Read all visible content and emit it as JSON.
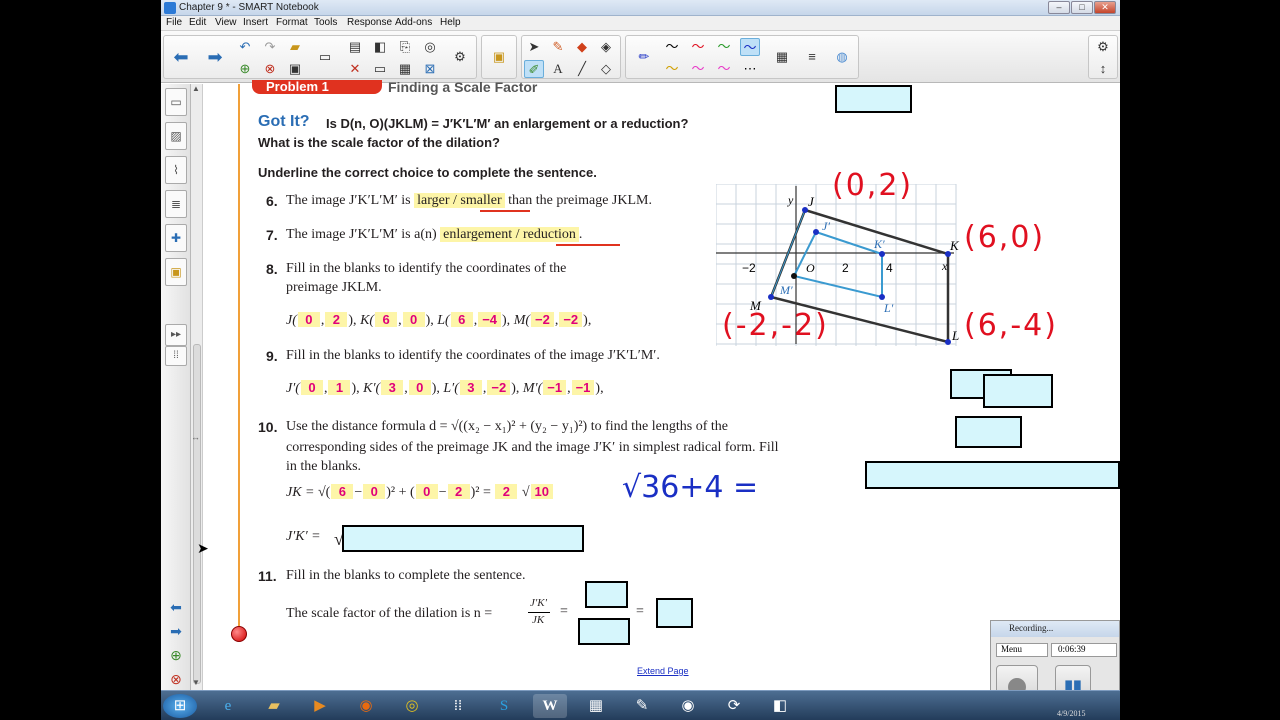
{
  "window": {
    "title": "Chapter 9 * - SMART Notebook",
    "minimize": "–",
    "maximize": "□",
    "close": "✕"
  },
  "menu": [
    "File",
    "Edit",
    "View",
    "Insert",
    "Format",
    "Tools",
    "Response",
    "Add-ons",
    "Help"
  ],
  "problem_header": {
    "label": "Problem 1",
    "title": "Finding a Scale Factor"
  },
  "got_it": {
    "label": "Got It?",
    "question_line1": "Is D(n, O)(JKLM) = J′K′L′M′ an enlargement or a reduction?",
    "question_line2": "What is the scale factor of the dilation?"
  },
  "instruction": "Underline the correct choice to complete the sentence.",
  "q6": {
    "num": "6.",
    "pre": "The image J′K′L′M′ is",
    "choice": "larger / smaller",
    "post": "than the preimage JKLM."
  },
  "q7": {
    "num": "7.",
    "pre": "The image J′K′L′M′ is a(n)",
    "choice": "enlargement / reduction",
    "post": "."
  },
  "q8": {
    "num": "8.",
    "line1": "Fill in the blanks to identify the coordinates of the",
    "line2": "preimage JKLM.",
    "J": [
      "0",
      "2"
    ],
    "K": [
      "6",
      "0"
    ],
    "L": [
      "6",
      "−4"
    ],
    "M": [
      "−2",
      "−2"
    ]
  },
  "q9": {
    "num": "9.",
    "line1": "Fill in the blanks to identify the coordinates of the image J′K′L′M′.",
    "J": [
      "0",
      "1"
    ],
    "K": [
      "3",
      "0"
    ],
    "L": [
      "3",
      "−2"
    ],
    "M": [
      "−1",
      "−1"
    ]
  },
  "q10": {
    "num": "10.",
    "line1": "Use the distance formula d = √((x₂ − x₁)² + (y₂ − y₁)²) to find the lengths of the",
    "line2": "corresponding sides of the preimage JK and the image J′K′ in simplest radical form. Fill",
    "line3": "in the blanks.",
    "jk_label": "JK =",
    "jk_a": "6",
    "jk_b": "0",
    "jk_c": "0",
    "jk_d": "2",
    "jk_coef": "2",
    "jk_rad": "10",
    "jpkp_label": "J′K′ ="
  },
  "q11": {
    "num": "11.",
    "line1": "Fill in the blanks to complete the sentence.",
    "line2": "The scale factor of the dilation is n =",
    "frac_num": "J′K′",
    "frac_den": "JK"
  },
  "annotations": {
    "j_coord": "(0,2)",
    "k_coord": "(6,0)",
    "m_coord": "(-2,-2)",
    "l_coord": "(6,-4)",
    "work": "√36+4 ="
  },
  "graph": {
    "y_label": "y",
    "x_label": "x",
    "ticks": [
      "−2",
      "O",
      "2",
      "4"
    ],
    "points": [
      "J",
      "K",
      "L",
      "M",
      "J′",
      "K′",
      "L′",
      "M′"
    ]
  },
  "extend_page": "Extend Page",
  "recording": {
    "title": "Recording...",
    "menu": "Menu",
    "time": "0:06:39"
  },
  "taskbar": {
    "date": "4/9/2015"
  },
  "colors": {
    "accent_blue": "#2a6db4",
    "highlight": "#fdf5a8",
    "answer_pink": "#e0007a",
    "ink_red": "#e01020",
    "ink_blue": "#1a2fc4",
    "box_cyan": "#d6f6fc"
  }
}
